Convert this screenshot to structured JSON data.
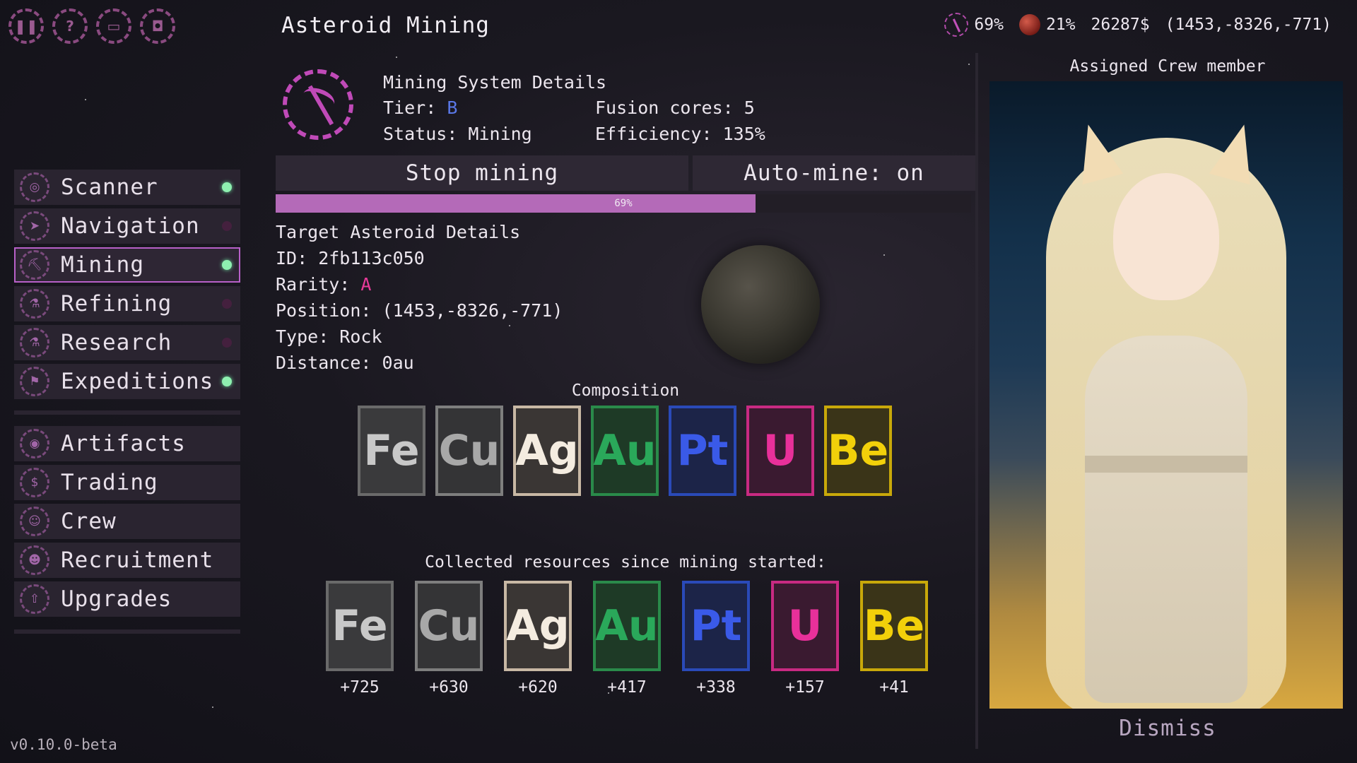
{
  "app_title": "Asteroid Mining",
  "top_icons": [
    {
      "name": "pause-icon",
      "glyph": "❚❚"
    },
    {
      "name": "help-icon",
      "glyph": "?"
    },
    {
      "name": "ticket-icon",
      "glyph": "▭"
    },
    {
      "name": "camera-icon",
      "glyph": "◘"
    }
  ],
  "stats": {
    "mining_percent": "69%",
    "planet_percent": "21%",
    "credits": "26287$",
    "position": "(1453,-8326,-771)"
  },
  "sidebar": {
    "primary": [
      {
        "label": "Scanner",
        "icon": "scanner-icon",
        "glyph": "◎",
        "active": false,
        "dot": true
      },
      {
        "label": "Navigation",
        "icon": "navigation-icon",
        "glyph": "➤",
        "active": false,
        "dot": false
      },
      {
        "label": "Mining",
        "icon": "pickaxe-icon",
        "glyph": "⛏",
        "active": true,
        "dot": true
      },
      {
        "label": "Refining",
        "icon": "refining-icon",
        "glyph": "⚗",
        "active": false,
        "dot": false
      },
      {
        "label": "Research",
        "icon": "flask-icon",
        "glyph": "⚗",
        "active": false,
        "dot": false
      },
      {
        "label": "Expeditions",
        "icon": "map-icon",
        "glyph": "⚑",
        "active": false,
        "dot": true
      }
    ],
    "secondary": [
      {
        "label": "Artifacts",
        "icon": "eye-icon",
        "glyph": "◉"
      },
      {
        "label": "Trading",
        "icon": "coin-icon",
        "glyph": "$"
      },
      {
        "label": "Crew",
        "icon": "crew-icon",
        "glyph": "☺"
      },
      {
        "label": "Recruitment",
        "icon": "recruit-icon",
        "glyph": "☻"
      },
      {
        "label": "Upgrades",
        "icon": "rocket-icon",
        "glyph": "⇧"
      }
    ]
  },
  "version": "v0.10.0-beta",
  "system": {
    "title": "Mining System Details",
    "tier_label": "Tier:",
    "tier_value": "B",
    "fusion_label": "Fusion cores: 5",
    "status_label": "Status: Mining",
    "efficiency_label": "Efficiency: 135%"
  },
  "buttons": {
    "stop": "Stop mining",
    "auto": "Auto-mine: on"
  },
  "progress": {
    "value": 0.69,
    "text": "69%"
  },
  "target": {
    "title": "Target Asteroid Details",
    "id": "ID: 2fb113c050",
    "rarity_label": "Rarity:",
    "rarity_value": "A",
    "position": "Position: (1453,-8326,-771)",
    "type": "Type: Rock",
    "distance": "Distance: 0au"
  },
  "composition": {
    "title": "Composition",
    "elements": [
      "Fe",
      "Cu",
      "Ag",
      "Au",
      "Pt",
      "U",
      "Be"
    ]
  },
  "collected": {
    "title": "Collected resources since mining started:",
    "items": [
      {
        "symbol": "Fe",
        "amount": "+725"
      },
      {
        "symbol": "Cu",
        "amount": "+630"
      },
      {
        "symbol": "Ag",
        "amount": "+620"
      },
      {
        "symbol": "Au",
        "amount": "+417"
      },
      {
        "symbol": "Pt",
        "amount": "+338"
      },
      {
        "symbol": "U",
        "amount": "+157"
      },
      {
        "symbol": "Be",
        "amount": "+41"
      }
    ]
  },
  "crew": {
    "title": "Assigned Crew member",
    "dismiss": "Dismiss"
  },
  "colors": {
    "accent": "#b860c8",
    "dot_on": "#8ef0b0",
    "tier": "#5a78e8",
    "rarity": "#e83a9a"
  }
}
